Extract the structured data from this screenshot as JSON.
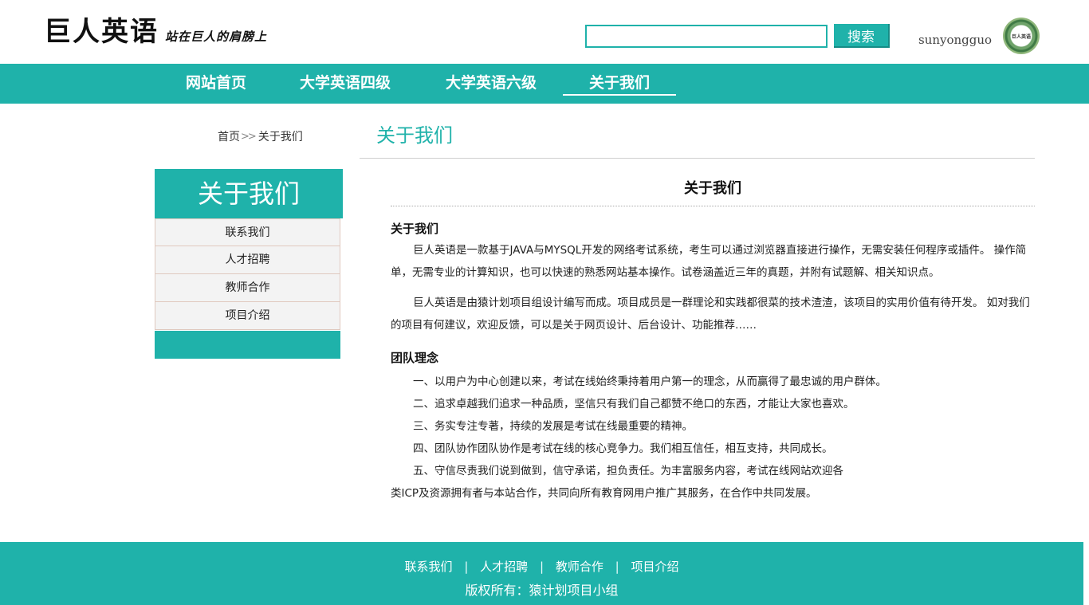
{
  "header": {
    "logo_main": "巨人英语",
    "logo_sub": "站在巨人的肩膀上",
    "search_value": "",
    "search_button": "搜索",
    "username": "sunyongguo",
    "avatar_text": "巨人英语"
  },
  "nav": {
    "items": [
      {
        "label": "网站首页"
      },
      {
        "label": "大学英语四级"
      },
      {
        "label": "大学英语六级"
      },
      {
        "label": "关于我们"
      }
    ],
    "active": "关于我们"
  },
  "breadcrumb": {
    "home": "首页",
    "separator": ">>",
    "current": "关于我们"
  },
  "page_title": "关于我们",
  "sidebar": {
    "heading": "关于我们",
    "items": [
      {
        "label": "联系我们"
      },
      {
        "label": "人才招聘"
      },
      {
        "label": "教师合作"
      },
      {
        "label": "项目介绍"
      }
    ]
  },
  "article": {
    "title": "关于我们",
    "section1_heading": "关于我们",
    "para1": "巨人英语是一款基于JAVA与MYSQL开发的网络考试系统，考生可以通过浏览器直接进行操作，无需安装任何程序或插件。 操作简单，无需专业的计算知识，也可以快速的熟悉网站基本操作。试卷涵盖近三年的真题，并附有试题解、相关知识点。",
    "para2": "巨人英语是由猿计划项目组设计编写而成。项目成员是一群理论和实践都很菜的技术渣渣，该项目的实用价值有待开发。 如对我们的项目有何建议，欢迎反馈，可以是关于网页设计、后台设计、功能推荐……",
    "section2_heading": "团队理念",
    "line1": "一、以用户为中心创建以来，考试在线始终秉持着用户第一的理念，从而赢得了最忠诚的用户群体。",
    "line2": "二、追求卓越我们追求一种品质，坚信只有我们自己都赞不绝口的东西，才能让大家也喜欢。",
    "line3": "三、务实专注专著，持续的发展是考试在线最重要的精神。",
    "line4": "四、团队协作团队协作是考试在线的核心竞争力。我们相互信任，相互支持，共同成长。",
    "line5a": "五、守信尽责我们说到做到，信守承诺，担负责任。为丰富服务内容，考试在线网站欢迎各",
    "line5b": "类ICP及资源拥有者与本站合作，共同向所有教育网用户推广其服务，在合作中共同发展。"
  },
  "footer": {
    "links": [
      {
        "label": "联系我们"
      },
      {
        "label": "人才招聘"
      },
      {
        "label": "教师合作"
      },
      {
        "label": "项目介绍"
      }
    ],
    "link_separator": "|",
    "copyright": "版权所有：猿计划项目小组"
  },
  "colors": {
    "accent": "#1fb2aa",
    "sidebar_item_bg": "#f3f3f3"
  }
}
